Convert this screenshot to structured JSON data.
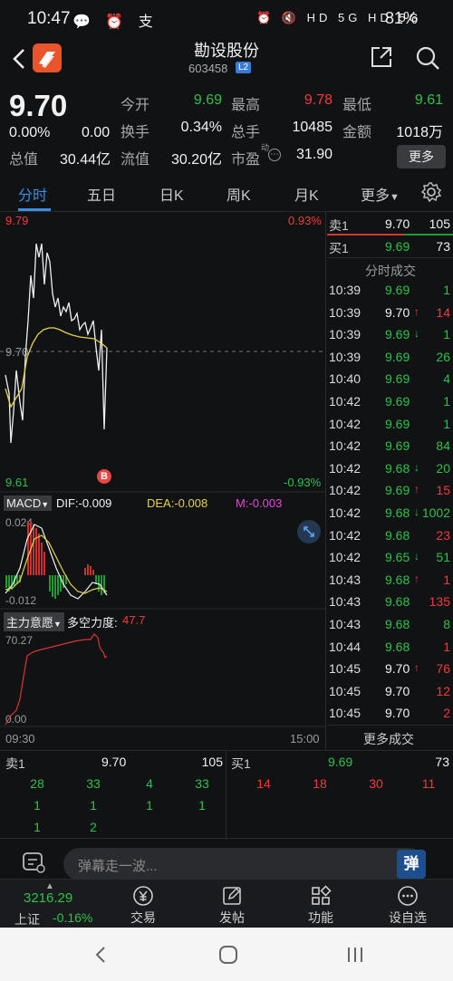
{
  "status_bar": {
    "time": "10:47",
    "left_icons": "💬 ⏰ 支",
    "right_icons": "⏰ 🔇 HD 5G HD 5G",
    "battery": "81%"
  },
  "header": {
    "stock_name": "勘设股份",
    "stock_code": "603458",
    "level_badge": "L2"
  },
  "quote": {
    "price": "9.70",
    "change_pct": "0.00%",
    "change_abs": "0.00",
    "open_label": "今开",
    "open_val": "9.69",
    "high_label": "最高",
    "high_val": "9.78",
    "low_label": "最低",
    "low_val": "9.61",
    "turnover_label": "换手",
    "turnover_val": "0.34%",
    "volume_label": "总手",
    "volume_val": "10485",
    "amount_label": "金额",
    "amount_val": "1018万",
    "mcap_label": "总值",
    "mcap_val": "30.44亿",
    "float_label": "流值",
    "float_val": "30.20亿",
    "pe_label": "市盈",
    "pe_sup": "动",
    "pe_val": "31.90",
    "more_label": "更多"
  },
  "tabs": [
    "分时",
    "五日",
    "日K",
    "周K",
    "月K",
    "更多"
  ],
  "chart": {
    "price_high": "9.79",
    "pct_high": "0.93%",
    "price_mid": "9.70",
    "price_low": "9.61",
    "pct_low": "-0.93%",
    "marker": "B",
    "macd_label": "MACD",
    "dif": "DIF:-0.009",
    "dea": "DEA:-0.008",
    "m": "M:-0.003",
    "macd_max": "0.024",
    "macd_min": "-0.012",
    "force_label": "主力意愿",
    "force_name": "多空力度:",
    "force_val": "47.7",
    "force_max": "70.27",
    "force_min": "0.00",
    "time_start": "09:30",
    "time_end": "15:00"
  },
  "right_panel": {
    "sell1_label": "卖1",
    "sell1_price": "9.70",
    "sell1_vol": "105",
    "buy1_label": "买1",
    "buy1_price": "9.69",
    "buy1_vol": "73",
    "trades_title": "分时成交",
    "more_trades": "更多成交",
    "trades": [
      {
        "t": "10:39",
        "p": "9.69",
        "a": "",
        "v": "1",
        "c": "green"
      },
      {
        "t": "10:39",
        "p": "9.70",
        "a": "↑",
        "v": "14",
        "c": "red"
      },
      {
        "t": "10:39",
        "p": "9.69",
        "a": "↓",
        "v": "1",
        "c": "green"
      },
      {
        "t": "10:39",
        "p": "9.69",
        "a": "",
        "v": "26",
        "c": "green"
      },
      {
        "t": "10:40",
        "p": "9.69",
        "a": "",
        "v": "4",
        "c": "green"
      },
      {
        "t": "10:42",
        "p": "9.69",
        "a": "",
        "v": "1",
        "c": "green"
      },
      {
        "t": "10:42",
        "p": "9.69",
        "a": "",
        "v": "1",
        "c": "green"
      },
      {
        "t": "10:42",
        "p": "9.69",
        "a": "",
        "v": "84",
        "c": "green"
      },
      {
        "t": "10:42",
        "p": "9.68",
        "a": "↓",
        "v": "20",
        "c": "green"
      },
      {
        "t": "10:42",
        "p": "9.69",
        "a": "↑",
        "v": "15",
        "c": "red"
      },
      {
        "t": "10:42",
        "p": "9.68",
        "a": "↓",
        "v": "1002",
        "c": "green"
      },
      {
        "t": "10:42",
        "p": "9.68",
        "a": "",
        "v": "23",
        "c": "red"
      },
      {
        "t": "10:42",
        "p": "9.65",
        "a": "↓",
        "v": "51",
        "c": "green"
      },
      {
        "t": "10:43",
        "p": "9.68",
        "a": "↑",
        "v": "1",
        "c": "red"
      },
      {
        "t": "10:43",
        "p": "9.68",
        "a": "",
        "v": "135",
        "c": "red"
      },
      {
        "t": "10:43",
        "p": "9.68",
        "a": "",
        "v": "8",
        "c": "green"
      },
      {
        "t": "10:44",
        "p": "9.68",
        "a": "",
        "v": "1",
        "c": "red"
      },
      {
        "t": "10:45",
        "p": "9.70",
        "a": "↑",
        "v": "76",
        "c": "red"
      },
      {
        "t": "10:45",
        "p": "9.70",
        "a": "",
        "v": "12",
        "c": "red"
      },
      {
        "t": "10:45",
        "p": "9.70",
        "a": "",
        "v": "2",
        "c": "red"
      }
    ]
  },
  "order_book": {
    "sell_label": "卖1",
    "sell_price": "9.70",
    "sell_vol": "105",
    "buy_label": "买1",
    "buy_price": "9.69",
    "buy_vol": "73",
    "sell_rows": [
      [
        "28",
        "33",
        "4",
        "33"
      ],
      [
        "1",
        "1",
        "1",
        "1"
      ],
      [
        "1",
        "2",
        "",
        ""
      ]
    ],
    "buy_rows": [
      [
        "14",
        "18",
        "30",
        "11"
      ]
    ]
  },
  "comment": {
    "placeholder": "弹幕走一波...",
    "danmu_label": "弹"
  },
  "bottom_nav": {
    "index_value": "3216.29",
    "index_name": "上证",
    "index_change": "-0.16%",
    "items": [
      "交易",
      "发帖",
      "功能",
      "设自选"
    ]
  }
}
